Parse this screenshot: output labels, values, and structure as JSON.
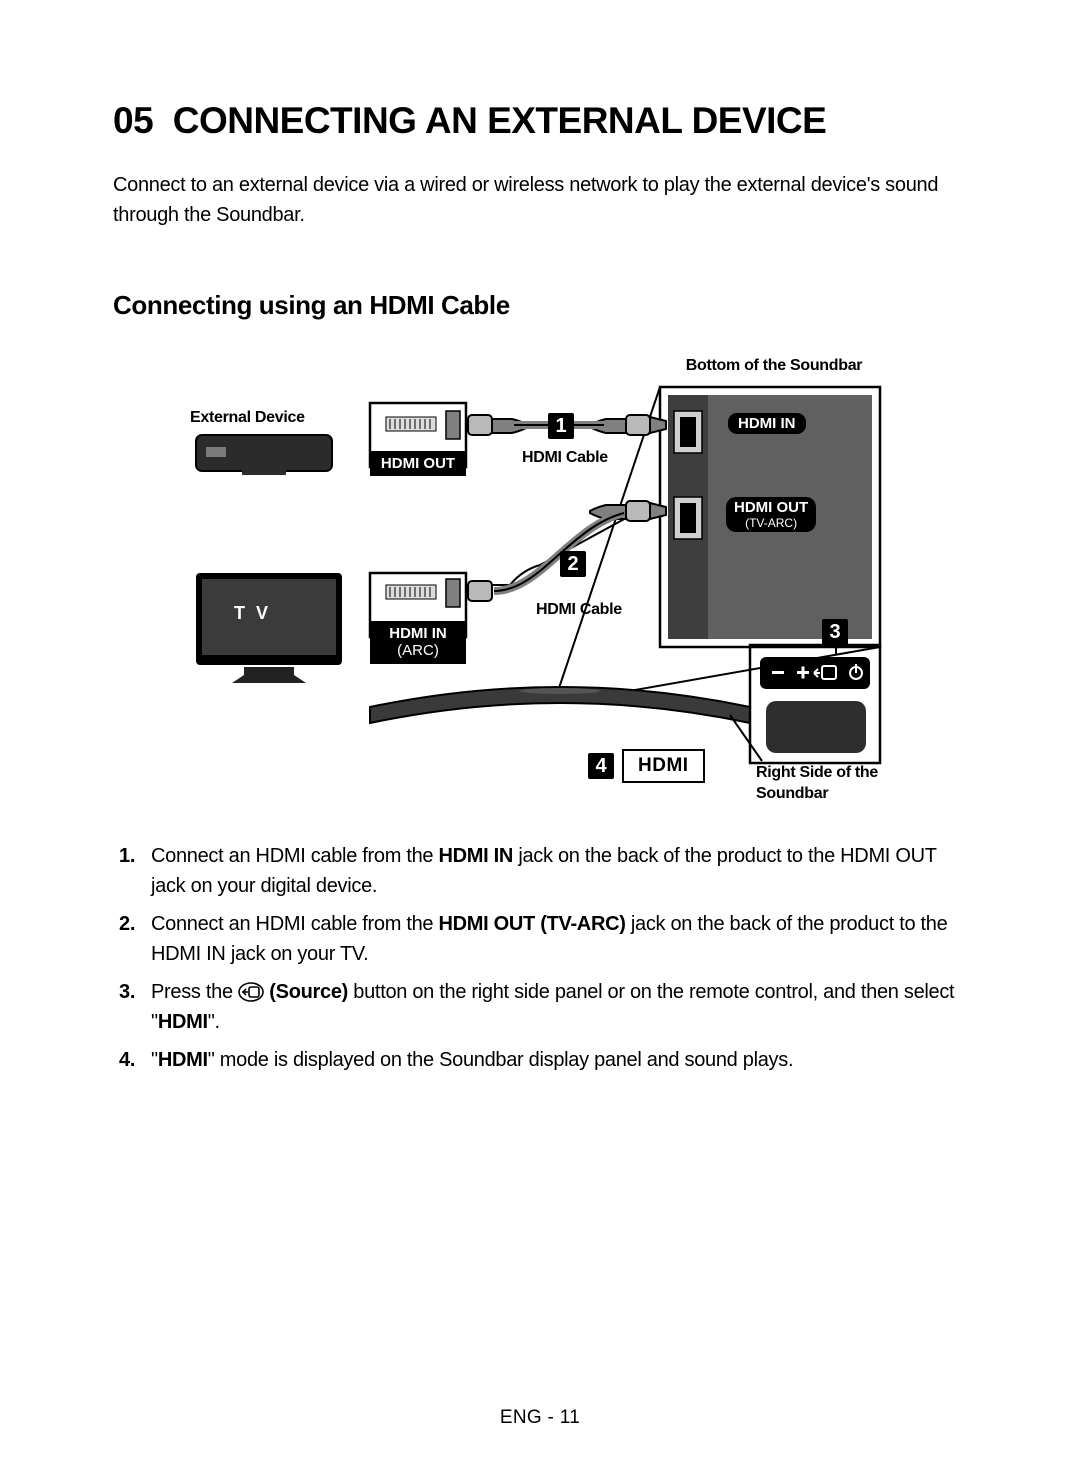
{
  "section_number": "05",
  "section_title": "CONNECTING AN EXTERNAL DEVICE",
  "intro": "Connect to an external device via a wired or wireless network to play the external device's sound through the Soundbar.",
  "subheading": "Connecting using an HDMI Cable",
  "diagram": {
    "bottom_of_soundbar": "Bottom of the Soundbar",
    "external_device": "External Device",
    "hdmi_out": "HDMI OUT",
    "hdmi_in_arc_line1": "HDMI IN",
    "hdmi_in_arc_line2": "(ARC)",
    "hdmi_in": "HDMI IN",
    "hdmi_out_tvarc_line1": "HDMI OUT",
    "hdmi_out_tvarc_line2": "(TV-ARC)",
    "tv": "T V",
    "hdmi_cable_1": "HDMI Cable",
    "hdmi_cable_2": "HDMI Cable",
    "right_side_line1": "Right Side of the",
    "right_side_line2": "Soundbar",
    "hdmi_box": "HDMI",
    "badge1": "1",
    "badge2": "2",
    "badge3": "3",
    "badge4": "4"
  },
  "steps": {
    "s1_a": "Connect an HDMI cable from the ",
    "s1_b": "HDMI IN",
    "s1_c": " jack on the back of the product to the HDMI OUT jack on your digital device.",
    "s2_a": "Connect an HDMI cable from the ",
    "s2_b": "HDMI OUT (TV-ARC)",
    "s2_c": " jack on the back of the product to the HDMI IN jack on your TV.",
    "s3_a": "Press the ",
    "s3_b": " (Source)",
    "s3_c": " button on the right side panel or on the remote control, and then select \"",
    "s3_d": "HDMI",
    "s3_e": "\".",
    "s4_a": "\"",
    "s4_b": "HDMI",
    "s4_c": "\" mode is displayed on the Soundbar display panel and sound plays."
  },
  "footer": "ENG - 11"
}
